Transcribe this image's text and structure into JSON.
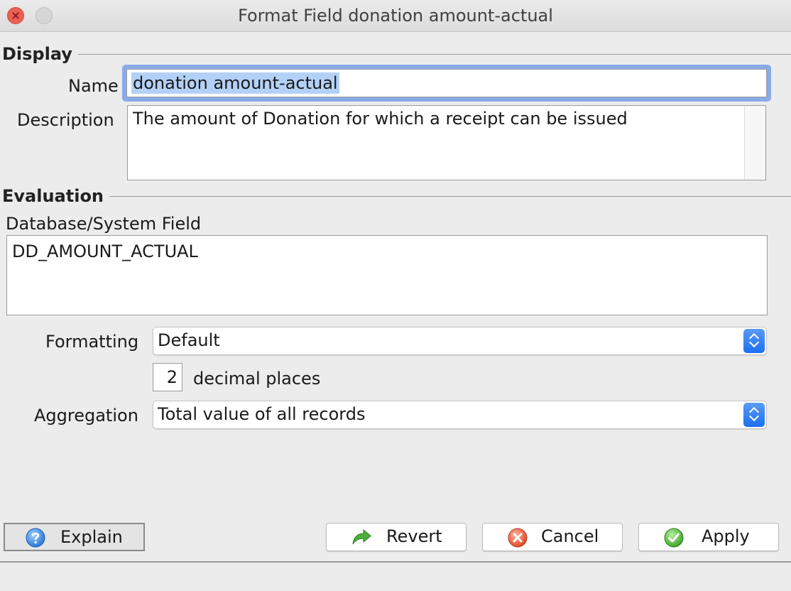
{
  "window": {
    "title": "Format Field donation amount-actual"
  },
  "display": {
    "section_title": "Display",
    "name_label": "Name",
    "name_value": "donation amount-actual",
    "description_label": "Description",
    "description_value": "The amount of Donation for which a receipt can be issued"
  },
  "evaluation": {
    "section_title": "Evaluation",
    "db_field_label": "Database/System Field",
    "db_field_value": "DD_AMOUNT_ACTUAL",
    "formatting_label": "Formatting",
    "formatting_value": "Default",
    "decimal_places_value": "2",
    "decimal_places_label": "decimal places",
    "aggregation_label": "Aggregation",
    "aggregation_value": "Total value of all records"
  },
  "buttons": {
    "explain": "Explain",
    "revert": "Revert",
    "cancel": "Cancel",
    "apply": "Apply"
  },
  "icons": {
    "explain": "help-icon",
    "revert": "revert-arrow-icon",
    "cancel": "cancel-icon",
    "apply": "checkmark-icon"
  },
  "colors": {
    "focus_ring": "#8aaae8",
    "selection": "#b3d1f7",
    "stepper_blue": "#1b6ff0"
  }
}
